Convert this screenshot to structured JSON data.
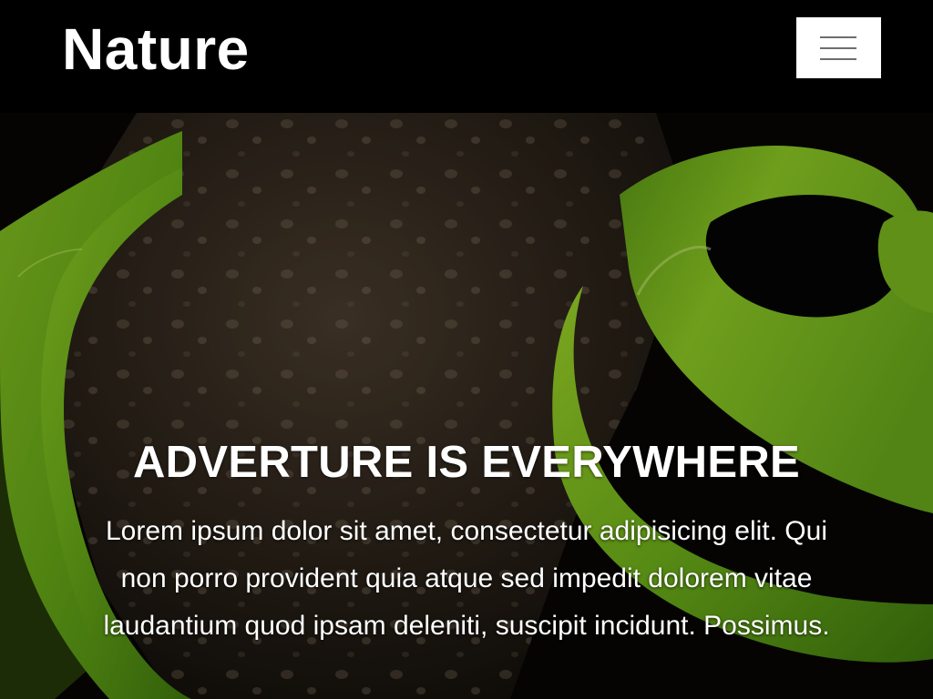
{
  "navbar": {
    "brand": "Nature",
    "menu_icon": "hamburger-menu-icon"
  },
  "hero": {
    "title": "ADVERTURE IS EVERYWHERE",
    "text": "Lorem ipsum dolor sit amet, consectetur adipisicing elit. Qui non porro provident quia atque sed impedit dolorem vitae laudantium quod ipsam deleniti, suscipit incidunt. Possimus.",
    "image_subject": "green snake coiled on tree bark"
  },
  "colors": {
    "background": "#000000",
    "snake_green": "#7fc01e",
    "bark_brown": "#3a2e22",
    "text": "#ffffff",
    "menu_button": "#ffffff"
  }
}
